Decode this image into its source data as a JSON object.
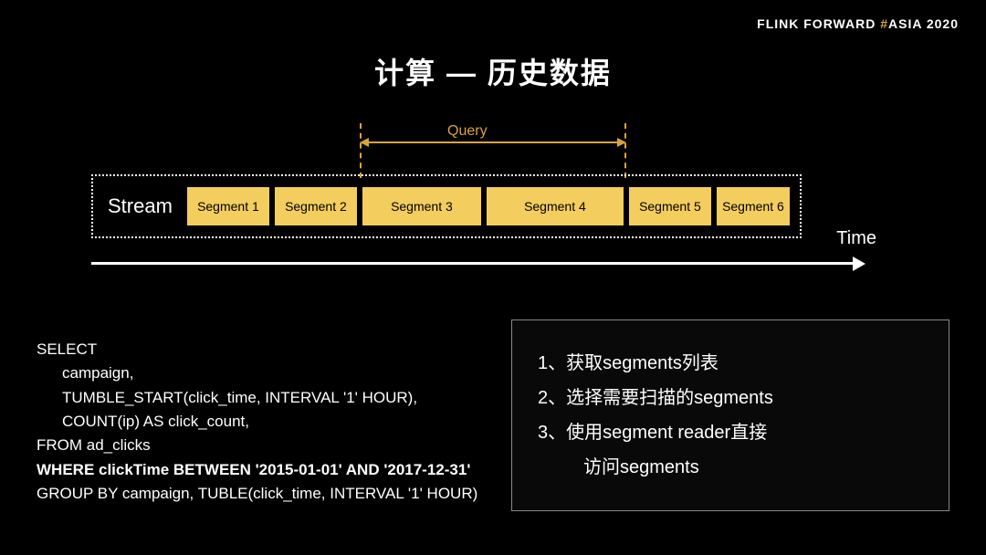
{
  "header": {
    "brand_pre": "FLINK  FORWARD ",
    "brand_hash": "#",
    "brand_post": "ASIA 2020"
  },
  "title": "计算 — 历史数据",
  "diagram": {
    "query_label": "Query",
    "stream_label": "Stream",
    "segments": [
      "Segment 1",
      "Segment 2",
      "Segment 3",
      "Segment 4",
      "Segment 5",
      "Segment 6"
    ],
    "time_label": "Time"
  },
  "sql": {
    "line1": "SELECT",
    "line2": "campaign,",
    "line3": "TUMBLE_START(click_time, INTERVAL '1' HOUR),",
    "line4": "COUNT(ip) AS click_count,",
    "line5": "FROM ad_clicks",
    "line6": "WHERE clickTime BETWEEN '2015-01-01' AND '2017-12-31'",
    "line7": "GROUP BY campaign, TUBLE(click_time, INTERVAL '1' HOUR)"
  },
  "steps": {
    "s1": "1、获取segments列表",
    "s2": "2、选择需要扫描的segments",
    "s3": "3、使用segment reader直接",
    "s3b": "访问segments"
  }
}
